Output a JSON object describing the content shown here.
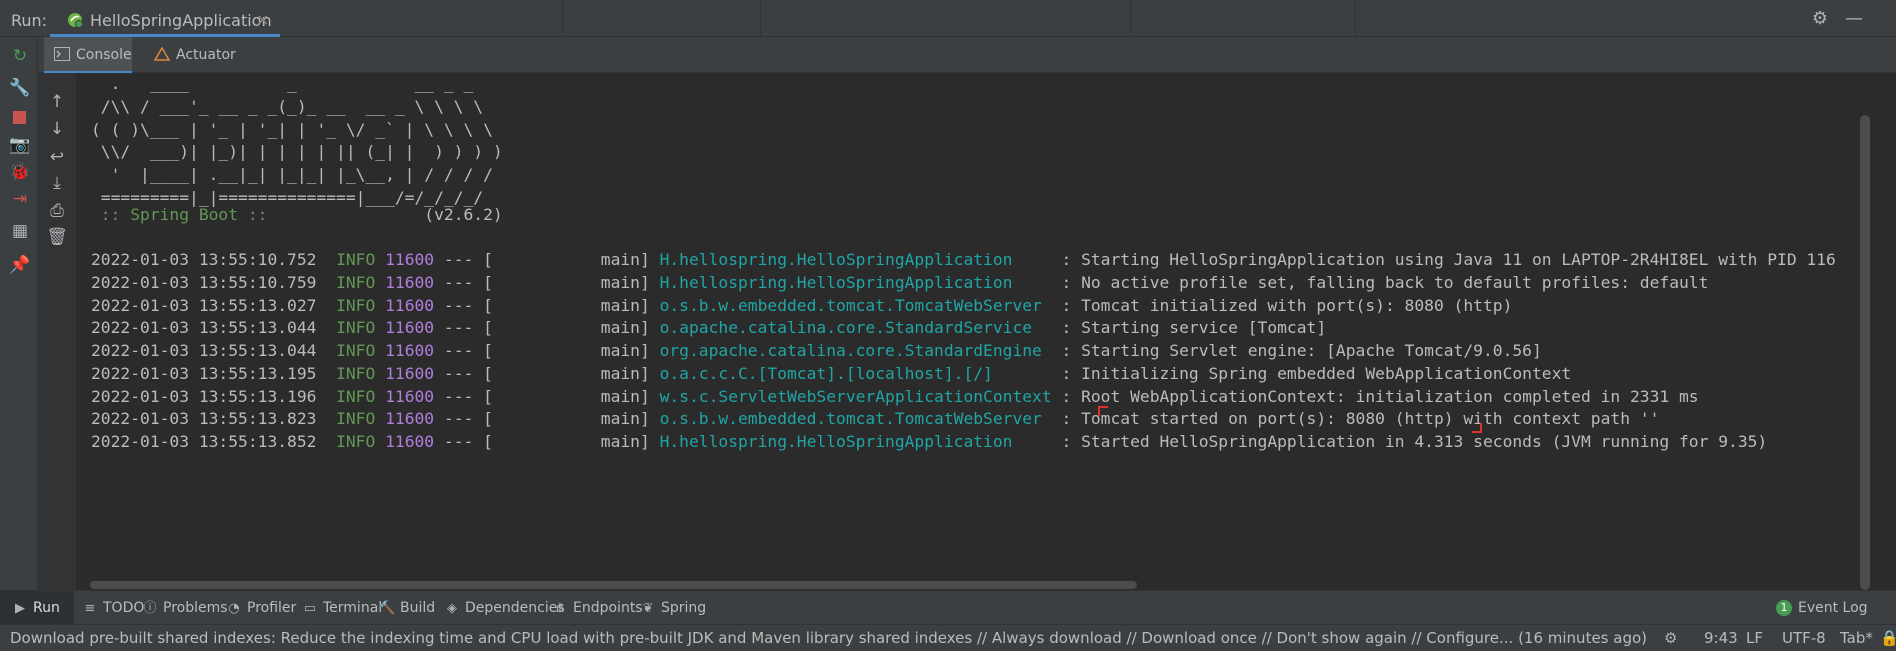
{
  "header": {
    "run_label": "Run:",
    "tab_title": "HelloSpringApplication",
    "close_glyph": "×"
  },
  "subtabs": [
    {
      "label": "Console",
      "icon": "console-icon",
      "active": true
    },
    {
      "label": "Actuator",
      "icon": "actuator-icon",
      "active": false
    }
  ],
  "banner": [
    "  .   ____          _            __ _ _",
    " /\\\\ / ___'_ __ _ _(_)_ __  __ _ \\ \\ \\ \\",
    "( ( )\\___ | '_ | '_| | '_ \\/ _` | \\ \\ \\ \\",
    " \\\\/  ___)| |_)| | | | | || (_| |  ) ) ) )",
    "  '  |____| .__|_| |_|_| |_\\__, | / / / /",
    " =========|_|==============|___/=/_/_/_/"
  ],
  "spring_boot": {
    "label": " :: Spring Boot :: ",
    "version": "               (v2.6.2)"
  },
  "logs": [
    {
      "time": "2022-01-03 13:55:10.752",
      "level": "INFO",
      "pid": "11600",
      "sep": " --- [",
      "thread": "           main] ",
      "logger": "H.hellospring.HelloSpringApplication    ",
      "message": " : Starting HelloSpringApplication using Java 11 on LAPTOP-2R4HI8EL with PID 116"
    },
    {
      "time": "2022-01-03 13:55:10.759",
      "level": "INFO",
      "pid": "11600",
      "sep": " --- [",
      "thread": "           main] ",
      "logger": "H.hellospring.HelloSpringApplication    ",
      "message": " : No active profile set, falling back to default profiles: default"
    },
    {
      "time": "2022-01-03 13:55:13.027",
      "level": "INFO",
      "pid": "11600",
      "sep": " --- [",
      "thread": "           main] ",
      "logger": "o.s.b.w.embedded.tomcat.TomcatWebServer ",
      "message": " : Tomcat initialized with port(s): 8080 (http)"
    },
    {
      "time": "2022-01-03 13:55:13.044",
      "level": "INFO",
      "pid": "11600",
      "sep": " --- [",
      "thread": "           main] ",
      "logger": "o.apache.catalina.core.StandardService  ",
      "message": " : Starting service [Tomcat]"
    },
    {
      "time": "2022-01-03 13:55:13.044",
      "level": "INFO",
      "pid": "11600",
      "sep": " --- [",
      "thread": "           main] ",
      "logger": "org.apache.catalina.core.StandardEngine ",
      "message": " : Starting Servlet engine: [Apache Tomcat/9.0.56]"
    },
    {
      "time": "2022-01-03 13:55:13.195",
      "level": "INFO",
      "pid": "11600",
      "sep": " --- [",
      "thread": "           main] ",
      "logger": "o.a.c.c.C.[Tomcat].[localhost].[/]      ",
      "message": " : Initializing Spring embedded WebApplicationContext"
    },
    {
      "time": "2022-01-03 13:55:13.196",
      "level": "INFO",
      "pid": "11600",
      "sep": " --- [",
      "thread": "           main] ",
      "logger": "w.s.c.ServletWebServerApplicationContext",
      "message": " : Root WebApplicationContext: initialization completed in 2331 ms"
    },
    {
      "time": "2022-01-03 13:55:13.823",
      "level": "INFO",
      "pid": "11600",
      "sep": " --- [",
      "thread": "           main] ",
      "logger": "o.s.b.w.embedded.tomcat.TomcatWebServer ",
      "message": " : Tomcat started on port(s): 8080 (http) with context path ''"
    },
    {
      "time": "2022-01-03 13:55:13.852",
      "level": "INFO",
      "pid": "11600",
      "sep": " --- [",
      "thread": "           main] ",
      "logger": "H.hellospring.HelloSpringApplication    ",
      "message": " : Started HelloSpringApplication in 4.313 seconds (JVM running for 9.35)"
    }
  ],
  "bottom_tabs": [
    {
      "label": "Run",
      "icon": "play-icon",
      "active": true
    },
    {
      "label": "TODO",
      "icon": "list-icon"
    },
    {
      "label": "Problems",
      "icon": "info-icon"
    },
    {
      "label": "Profiler",
      "icon": "profiler-icon"
    },
    {
      "label": "Terminal",
      "icon": "terminal-icon"
    },
    {
      "label": "Build",
      "icon": "hammer-icon"
    },
    {
      "label": "Dependencies",
      "icon": "layers-icon"
    },
    {
      "label": "Endpoints",
      "icon": "endpoints-icon"
    },
    {
      "label": "Spring",
      "icon": "spring-leaf-icon"
    }
  ],
  "event_log": {
    "label": "Event Log",
    "count": "1"
  },
  "status": {
    "message": "Download pre-built shared indexes: Reduce the indexing time and CPU load with pre-built JDK and Maven library shared indexes // Always download // Download once // Don't show again // Configure... (16 minutes ago)",
    "time": "9:43",
    "line_sep": "LF",
    "encoding": "UTF-8",
    "indent": "Tab*"
  },
  "colors": {
    "accent": "#4a88c7",
    "info": "#629755",
    "pid": "#b07ddb",
    "logger": "#20a5a5",
    "stop": "#c75450",
    "rerun": "#499c54"
  }
}
